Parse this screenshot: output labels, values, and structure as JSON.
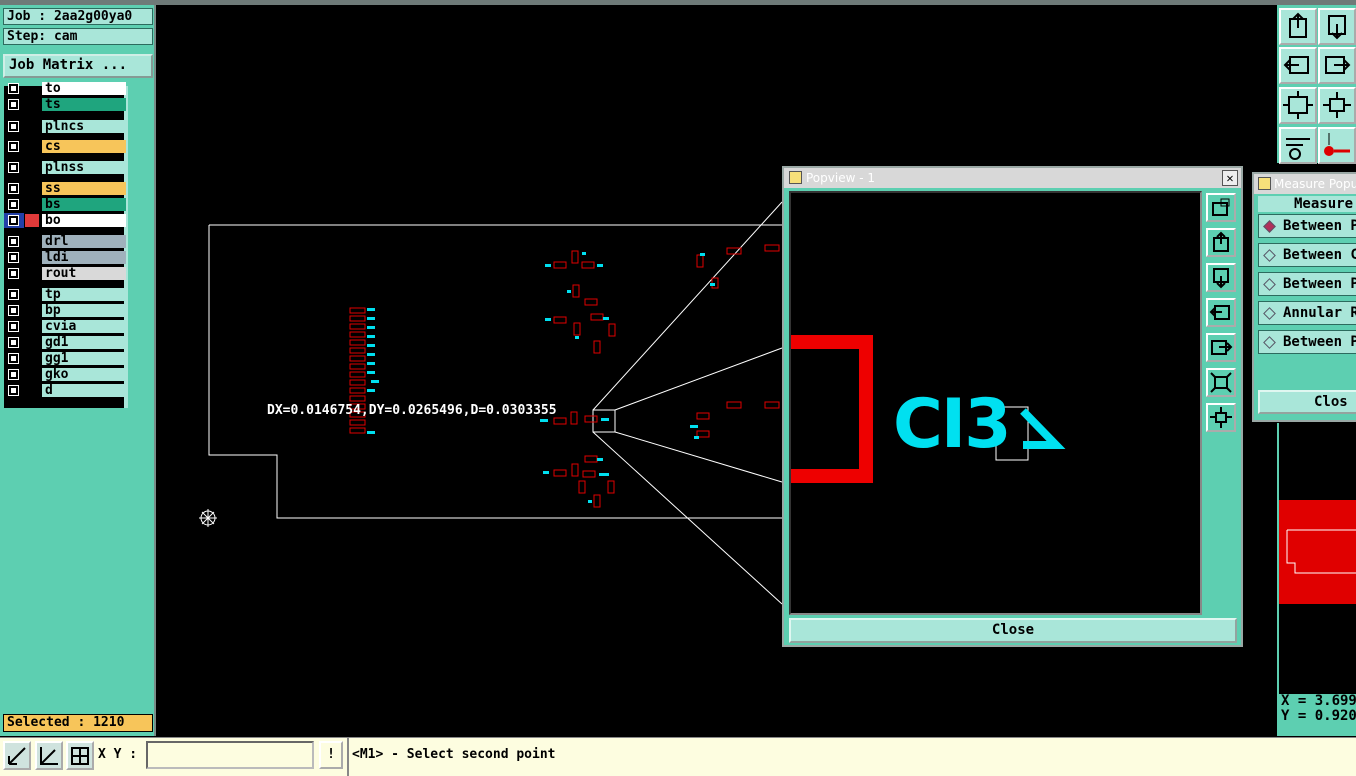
{
  "job_label": "Job : 2aa2g00ya0",
  "step_label": "Step: cam",
  "job_matrix_button": "Job Matrix ...",
  "layers": [
    {
      "name": "to",
      "color": "#ffffff"
    },
    {
      "name": "ts",
      "color": "#1fa57e"
    },
    {
      "name": "plncs",
      "color": "#a9e6d9"
    },
    {
      "name": "cs",
      "color": "#f7c55a"
    },
    {
      "name": "plnss",
      "color": "#a9e6d9"
    },
    {
      "name": "ss",
      "color": "#f7c55a"
    },
    {
      "name": "bs",
      "color": "#1fa57e"
    },
    {
      "name": "bo",
      "color": "#ffffff"
    },
    {
      "name": "drl",
      "color": "#9fb1bc"
    },
    {
      "name": "ldi",
      "color": "#9fb1bc"
    },
    {
      "name": "rout",
      "color": "#d9d9d9"
    },
    {
      "name": "tp",
      "color": "#a9e6d9"
    },
    {
      "name": "bp",
      "color": "#a9e6d9"
    },
    {
      "name": "cvia",
      "color": "#a9e6d9"
    },
    {
      "name": "gd1",
      "color": "#a9e6d9"
    },
    {
      "name": "gg1",
      "color": "#a9e6d9"
    },
    {
      "name": "gko",
      "color": "#a9e6d9"
    },
    {
      "name": "d",
      "color": "#a9e6d9"
    }
  ],
  "selected_label": "Selected : 1210",
  "measure_readout": "DX=0.0146754,DY=0.0265496,D=0.0303355",
  "popview": {
    "title": "Popview - 1",
    "close_label": "Close",
    "zoom_text": "CI3",
    "close_x": "✕"
  },
  "measure_popup": {
    "title": "Measure Popu",
    "header": "Measure",
    "options": [
      "Between P",
      "Between C",
      "Between P",
      "Annular R",
      "Between P"
    ],
    "selected_index": 0,
    "close_label": "Clos"
  },
  "coordinates": {
    "x_label": "X = 3.699",
    "y_label": "Y = 0.920"
  },
  "command_bar": {
    "xy_label": "X Y :",
    "xy_value": "",
    "warning_icon": "!",
    "prompt": "<M1> - Select second point"
  },
  "colors": {
    "panel": "#5dcfb1",
    "feature_red": "#e00000",
    "text_cyan": "#00e0f0"
  }
}
